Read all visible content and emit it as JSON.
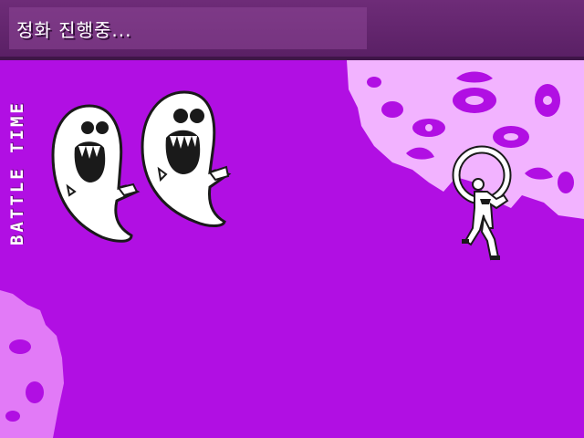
{
  "message": {
    "text": "정화 진행중..."
  },
  "side_label": {
    "text": "BATTLE TIME"
  },
  "colors": {
    "background": "#b10fe3",
    "damask": "#f2b3ff",
    "damask_faded": "#e27af7",
    "message_bar": "#6e2c78",
    "ghost_body": "#ffffff",
    "ghost_outline": "#1a1a1a"
  },
  "sprites": {
    "ghost_left": "ghost-icon",
    "ghost_right": "ghost-icon",
    "player": "exorcist-with-halo-icon"
  }
}
